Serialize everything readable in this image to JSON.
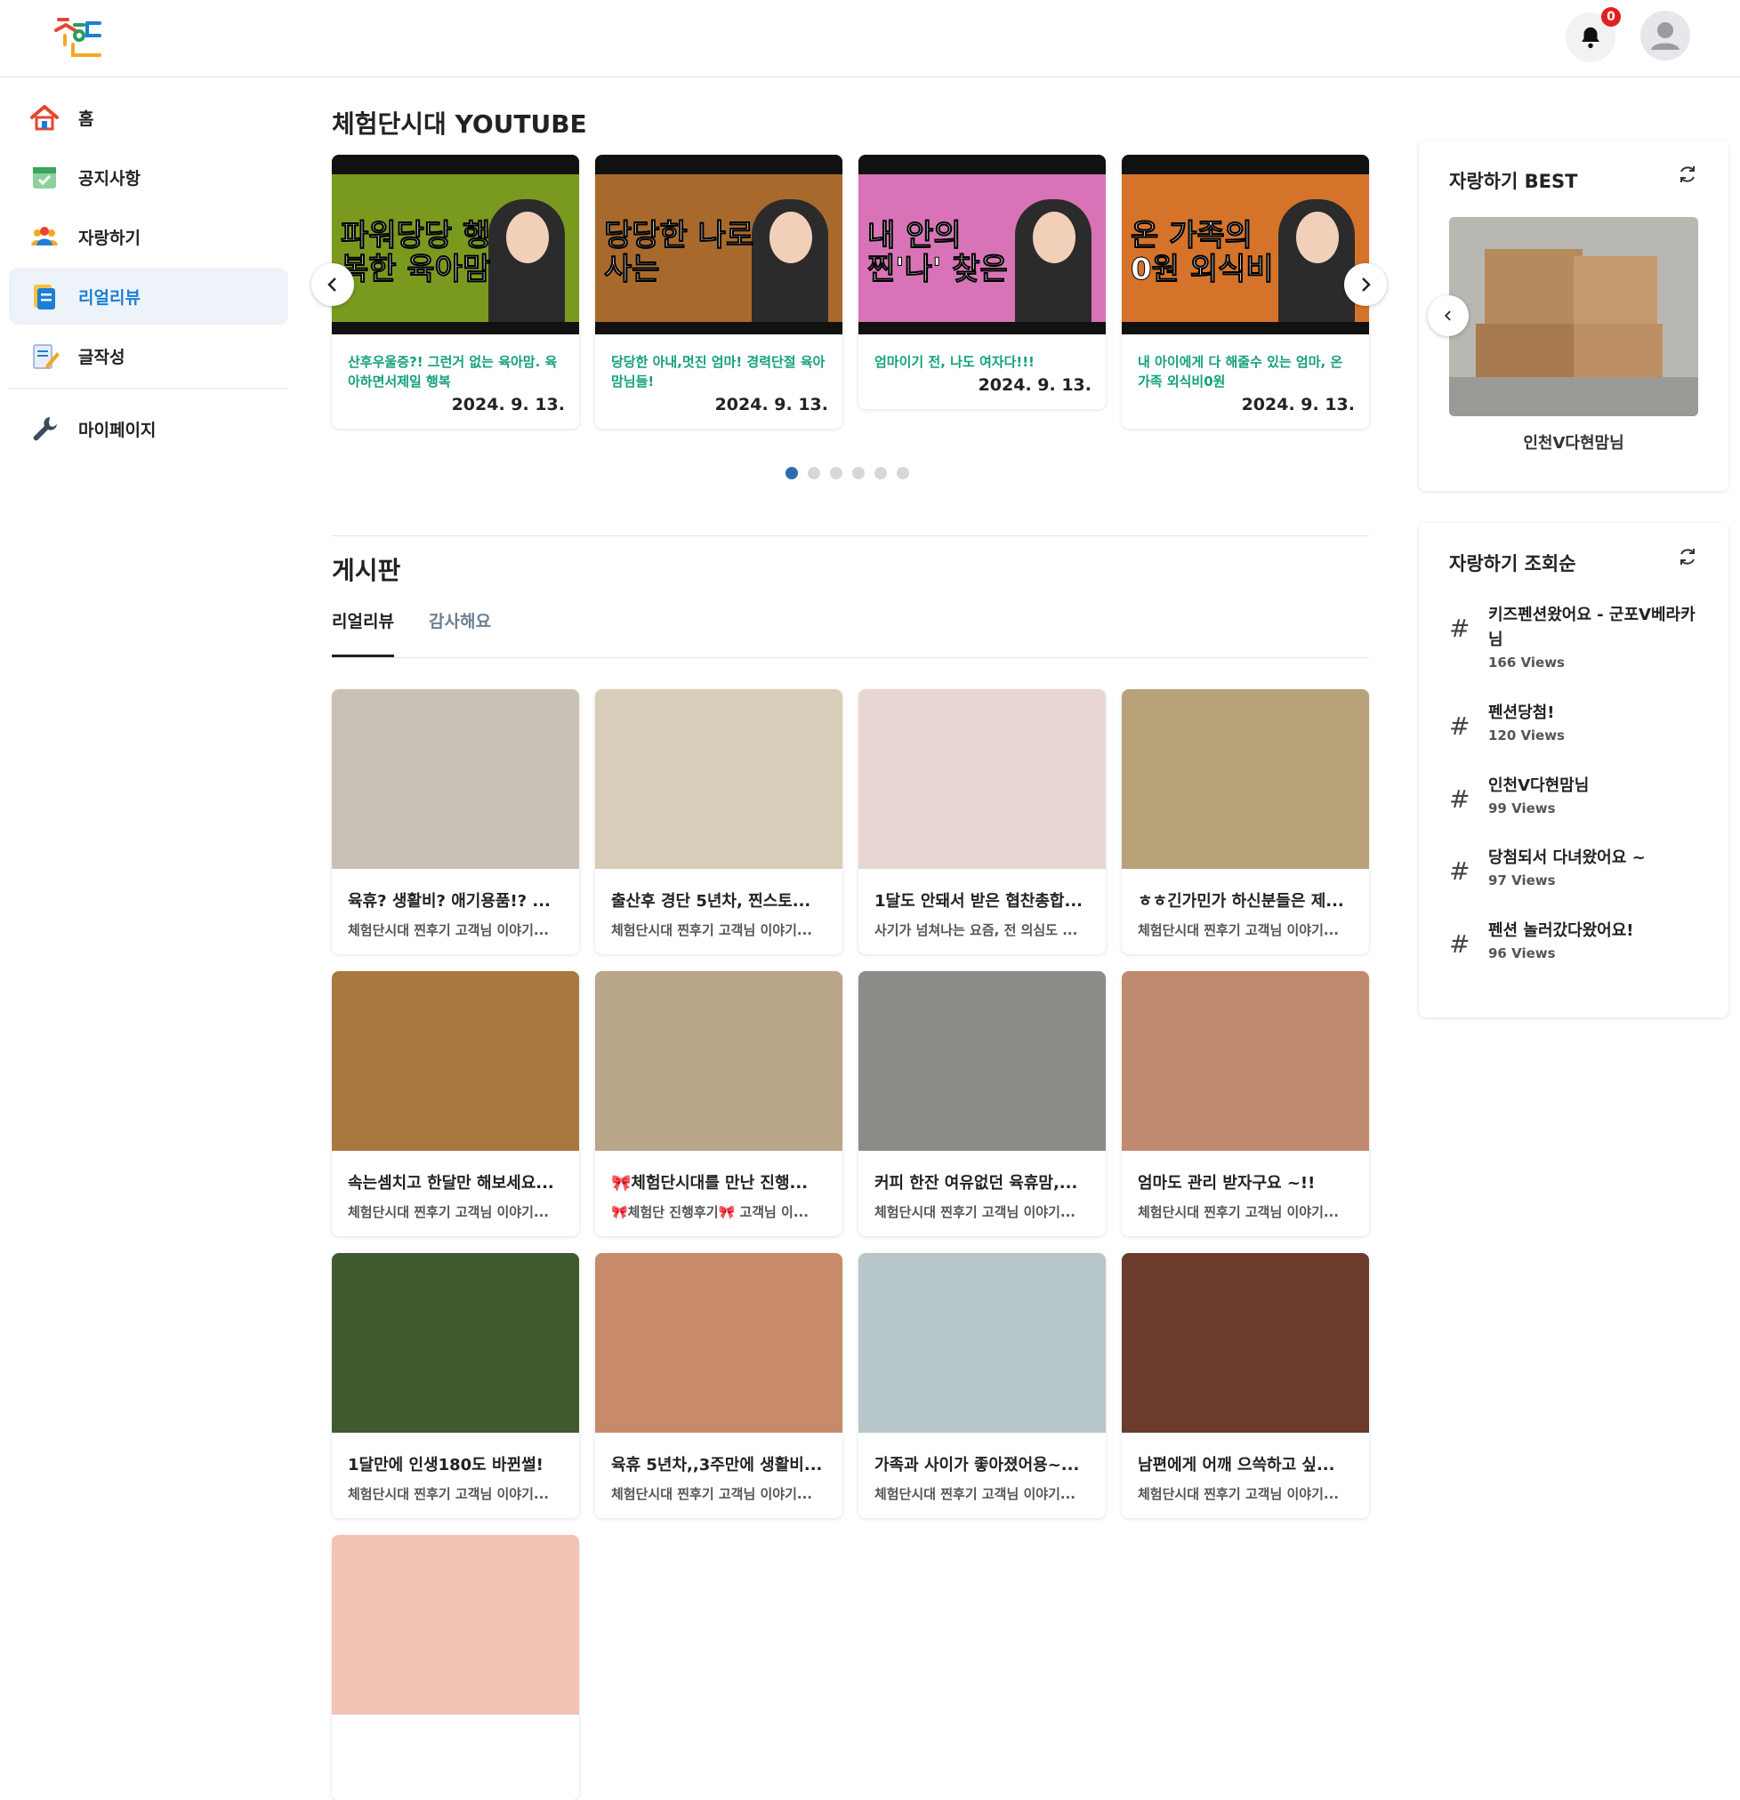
{
  "header": {
    "logo_alt": "체험단시대",
    "notification_count": "0"
  },
  "sidebar": {
    "items": [
      {
        "label": "홈",
        "icon": "home-icon",
        "active": false
      },
      {
        "label": "공지사항",
        "icon": "calendar-check-icon",
        "active": false
      },
      {
        "label": "자랑하기",
        "icon": "people-icon",
        "active": false
      },
      {
        "label": "리얼리뷰",
        "icon": "document-icon",
        "active": true
      },
      {
        "label": "글작성",
        "icon": "edit-note-icon",
        "active": false
      }
    ],
    "mypage": {
      "label": "마이페이지",
      "icon": "wrench-icon"
    }
  },
  "youtube": {
    "title": "체험단시대 YOUTUBE",
    "cards": [
      {
        "title": "산후우울증?! 그런거 없는 육아맘. 육아하면서제일 행복",
        "date": "2024. 9. 13.",
        "thumb_text": "파워당당 행복한 육아맘",
        "thumb_color": "#7a9a1f"
      },
      {
        "title": "당당한 아내,멋진 엄마! 경력단절 육아맘님들!",
        "date": "2024. 9. 13.",
        "thumb_text": "당당한 나로 사는",
        "thumb_color": "#a86a2c"
      },
      {
        "title": "엄마이기 전, 나도 여자다!!!",
        "date": "2024. 9. 13.",
        "thumb_text": "내 안의 찐'나' 찾은",
        "thumb_color": "#d973b8"
      },
      {
        "title": "내 아이에게 다 해줄수 있는 엄마, 온가족 외식비0원",
        "date": "2024. 9. 13.",
        "thumb_text": "온 가족의 0원 외식비",
        "thumb_color": "#d6732a"
      }
    ],
    "dots_total": 6,
    "dots_active": 0
  },
  "board": {
    "title": "게시판",
    "tabs": [
      "리얼리뷰",
      "감사해요"
    ],
    "active_tab": 0,
    "posts": [
      {
        "title": "육휴? 생활비? 애기용품!? ...",
        "sub": "체험단시대 찐후기 고객님 이야기...",
        "color": "#c9c1b6"
      },
      {
        "title": "출산후 경단 5년차, 찐스토...",
        "sub": "체험단시대 찐후기 고객님 이야기...",
        "color": "#d8cdb8"
      },
      {
        "title": "1달도 안돼서 받은 협찬총합...",
        "sub": "사기가 넘쳐나는 요즘, 전 의심도 ...",
        "color": "#e8d6d4"
      },
      {
        "title": "ㅎㅎ긴가민가 하신분들은 제...",
        "sub": "체험단시대 찐후기 고객님 이야기...",
        "color": "#b8a27a"
      },
      {
        "title": "속는셈치고 한달만 해보세요...",
        "sub": "체험단시대 찐후기 고객님 이야기...",
        "color": "#a9783f"
      },
      {
        "title": "🎀체험단시대를 만난 진행...",
        "sub": "🎀체험단 진행후기🎀 고객님 이...",
        "color": "#b9a58a"
      },
      {
        "title": "커피 한잔 여유없던 육휴맘,...",
        "sub": "체험단시대 찐후기 고객님 이야기...",
        "color": "#8d8b88"
      },
      {
        "title": "엄마도 관리 받자구요 ~!!",
        "sub": "체험단시대 찐후기 고객님 이야기...",
        "color": "#c08a6e"
      },
      {
        "title": "1달만에 인생180도 바뀐썰!",
        "sub": "체험단시대 찐후기 고객님 이야기...",
        "color": "#3f5a2e"
      },
      {
        "title": "육휴 5년차,,3주만에 생활비...",
        "sub": "체험단시대 찐후기 고객님 이야기...",
        "color": "#c78a6a"
      },
      {
        "title": "가족과 사이가 좋아졌어용~...",
        "sub": "체험단시대 찐후기 고객님 이야기...",
        "color": "#b7c6c9"
      },
      {
        "title": "남편에게 어깨 으쓱하고 싶...",
        "sub": "체험단시대 찐후기 고객님 이야기...",
        "color": "#6b3b2c"
      },
      {
        "title": "",
        "sub": "",
        "color": "#f1c3b4"
      }
    ]
  },
  "best_panel": {
    "title": "자랑하기 BEST",
    "name": "인천V다현맘님"
  },
  "views_panel": {
    "title": "자랑하기 조회순",
    "items": [
      {
        "title": "키즈펜션왔어요 - 군포V베라카님",
        "views": "166 Views"
      },
      {
        "title": "펜션당첨!",
        "views": "120 Views"
      },
      {
        "title": "인천V다현맘님",
        "views": "99 Views"
      },
      {
        "title": "당첨되서 다녀왔어요 ~",
        "views": "97 Views"
      },
      {
        "title": "펜션 놀러갔다왔어요!",
        "views": "96 Views"
      }
    ]
  }
}
